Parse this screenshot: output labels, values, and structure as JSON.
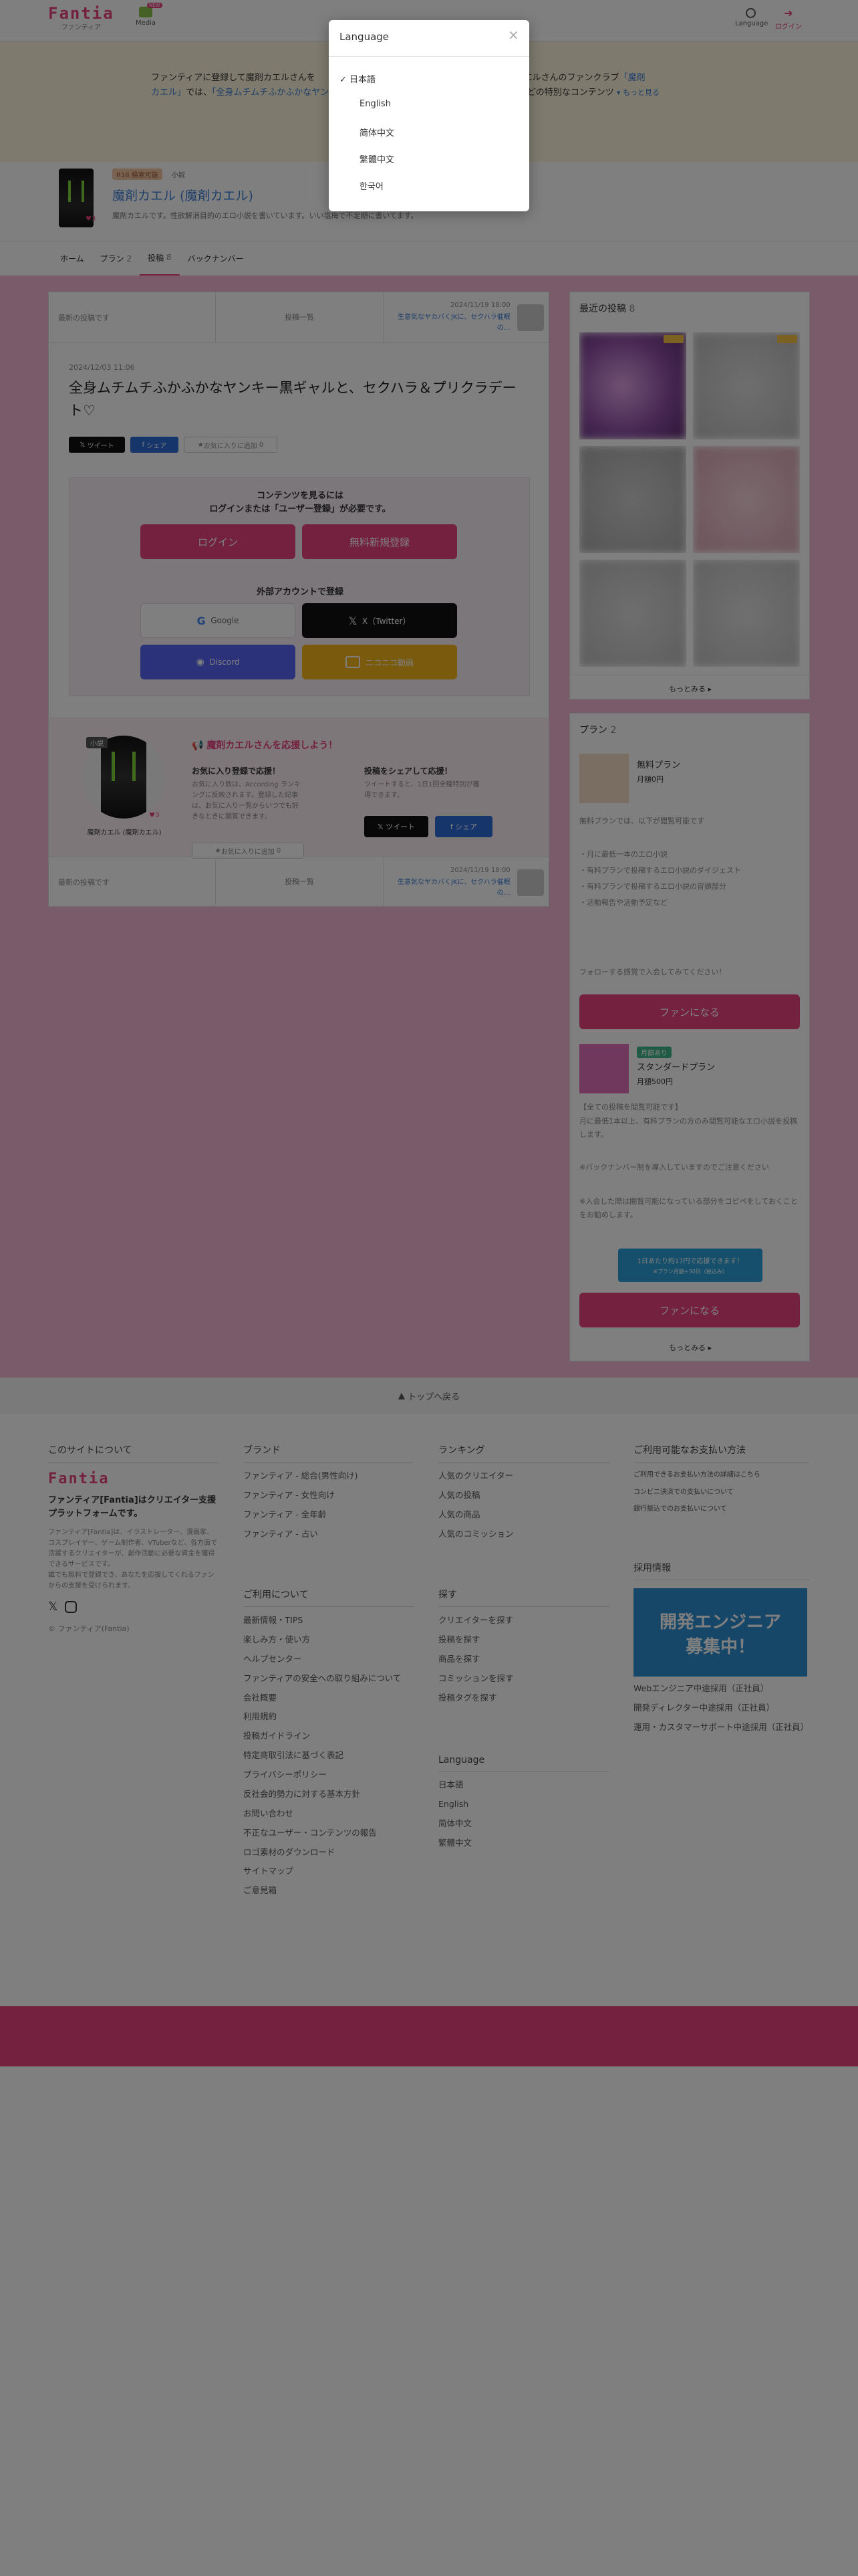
{
  "header": {
    "logo": "Fantia",
    "logo_sub": "ファンティア",
    "nav_media": "Media",
    "nav_media_badge": "NEW",
    "nav_language": "Language",
    "nav_login": "ログイン"
  },
  "hero": {
    "text_a": "ファンティアに登録して魔剤カエルさんを",
    "text_b": "す。魔剤カエルさんのファンクラブ",
    "link_a": "「魔剤",
    "text_c": "カエル」",
    "text_d": "では、",
    "highlight": "「全身ムチムチふかふかなヤンキー黒ギャルと、セクハラ＆プリクラデート♡」",
    "text_e": "などの特別なコンテンツ",
    "more": "もっと見る"
  },
  "profile": {
    "tag1": "R18 検索可能",
    "tag2": "小説",
    "name": "魔剤カエル (魔剤カエル)",
    "desc": "魔剤カエルです。性欲解消目的のエロ小説を書いています。いい塩梅で不定期に書いてます。",
    "badge": "3"
  },
  "tabs": [
    {
      "label": "ホーム",
      "count": ""
    },
    {
      "label": "プラン",
      "count": "2"
    },
    {
      "label": "投稿",
      "count": "8"
    },
    {
      "label": "バックナンバー",
      "count": ""
    }
  ],
  "postnav": {
    "latest": "最新の投稿です",
    "list": "投稿一覧",
    "next_date": "2024/11/19 18:00",
    "next_title": "生意気なヤカバくJKに、セクハラ催眠の…"
  },
  "postnav_bottom": {
    "latest": "最新の投稿です",
    "list": "投稿一覧",
    "next_date": "2024/11/19 18:00",
    "next_title": "生意気なヤカバくJKに、セクハラ催眠の…"
  },
  "post": {
    "date": "2024/12/03 11:06",
    "title": "全身ムチムチふかふかなヤンキー黒ギャルと、セクハラ＆プリクラデート♡",
    "tweet": "ツイート",
    "share": "シェア",
    "fav": "お気に入りに追加",
    "fav_count": "0"
  },
  "gate": {
    "line1": "コンテンツを見るには",
    "line2": "ログインまたは「ユーザー登録」が必要です。",
    "login": "ログイン",
    "signup": "無料新規登録",
    "external": "外部アカウントで登録",
    "google": "Google",
    "x": "X（Twitter）",
    "discord": "Discord",
    "other": "ニコニコ動画"
  },
  "support": {
    "avatar_tag": "小説",
    "name": "魔剤カエル (魔剤カエル)",
    "badge": "3",
    "heading": "魔剤カエルさんを応援しよう！",
    "fav_h": "お気に入り登録で応援！",
    "fav_p": "お気に入り数は、According ランキングに反映されます。登録した記事は、お気に入り一覧からいつでも好きなときに閲覧できます。",
    "fav_btn": "お気に入りに追加",
    "fav_count": "0",
    "share_h": "投稿をシェアして応援！",
    "share_p": "ツイートすると、1日1回全種特別が獲得できます。",
    "tweet": "ツイート",
    "share": "シェア"
  },
  "sidebar": {
    "recent_title": "最近の投稿",
    "recent_count": "8",
    "more": "もっとみる",
    "plan_title": "プラン",
    "plan_count": "2",
    "free_plan": {
      "name": "無料プラン",
      "price": "月額0円",
      "desc": "無料プランでは、以下が閲覧可能です",
      "items": [
        "・月に最低一本のエロ小説",
        "・有料プランで投稿するエロ小説のダイジェスト",
        "・有料プランで投稿するエロ小説の冒頭部分",
        "・活動報告や活動予定など"
      ],
      "follow": "フォローする感覚で入会してみてください！",
      "button": "ファンになる"
    },
    "std_plan": {
      "tag": "月額あり",
      "name": "スタンダードプラン",
      "price": "月額500円",
      "desc1": "【全ての投稿を閲覧可能です】",
      "desc2": "月に最低1本以上、有料プランの方のみ閲覧可能なエロ小説を投稿します。",
      "desc3": "※バックナンバー制を導入していますのでご注意ください",
      "desc4": "※入会した際は閲覧可能になっている部分をコピペをしておくことをお勧めします。",
      "promo1": "1日あたり約17円で応援できます！",
      "promo2": "※プラン月額÷30日（税込み）",
      "button": "ファンになる"
    },
    "more2": "もっとみる"
  },
  "totop": "トップへ戻る",
  "footer": {
    "about": {
      "title": "このサイトについて",
      "logo": "Fantia",
      "lead": "ファンティア[Fantia]はクリエイター支援プラットフォームです。",
      "body": "ファンティア[Fantia]は、イラストレーター、漫画家、コスプレイヤー、ゲーム制作者、VTuberなど、各方面で活躍するクリエイターが、創作活動に必要な資金を獲得できるサービスです。",
      "body2": "誰でも無料で登録でき、あなたを応援してくれるファンからの支援を受けられます。",
      "copyright": "© ファンティア(Fantia)"
    },
    "brand": {
      "title": "ブランド",
      "items": [
        "ファンティア - 総合(男性向け)",
        "ファンティア - 女性向け",
        "ファンティア - 全年齢",
        "ファンティア - 占い"
      ]
    },
    "ranking": {
      "title": "ランキング",
      "items": [
        "人気のクリエイター",
        "人気の投稿",
        "人気の商品",
        "人気のコミッション"
      ]
    },
    "payment": {
      "title": "ご利用可能なお支払い方法",
      "items": [
        "ご利用できるお支払い方法の詳細はこちら",
        "コンビニ決済での支払いについて",
        "銀行振込でのお支払いについて"
      ]
    },
    "usage": {
      "title": "ご利用について",
      "items": [
        "最新情報・TIPS",
        "楽しみ方・使い方",
        "ヘルプセンター",
        "ファンティアの安全への取り組みについて",
        "会社概要",
        "利用規約",
        "投稿ガイドライン",
        "特定商取引法に基づく表記",
        "プライバシーポリシー",
        "反社会的勢力に対する基本方針",
        "お問い合わせ",
        "不正なユーザー・コンテンツの報告",
        "ロゴ素材のダウンロード",
        "サイトマップ",
        "ご意見箱"
      ]
    },
    "search": {
      "title": "探す",
      "items": [
        "クリエイターを探す",
        "投稿を探す",
        "商品を探す",
        "コミッションを探す",
        "投稿タグを探す"
      ]
    },
    "recruit": {
      "title": "採用情報",
      "banner1": "開発エンジニア",
      "banner2": "募集中！",
      "items": [
        "Webエンジニア中途採用（正社員）",
        "開発ディレクター中途採用（正社員）",
        "運用・カスタマーサポート中途採用（正社員）"
      ]
    },
    "language": {
      "title": "Language",
      "items": [
        "日本語",
        "English",
        "简体中文",
        "繁體中文"
      ]
    }
  },
  "modal": {
    "title": "Language",
    "close": "×",
    "options": [
      "日本語",
      "English",
      "简体中文",
      "繁體中文",
      "한국어"
    ],
    "selected_mark": "✓"
  }
}
